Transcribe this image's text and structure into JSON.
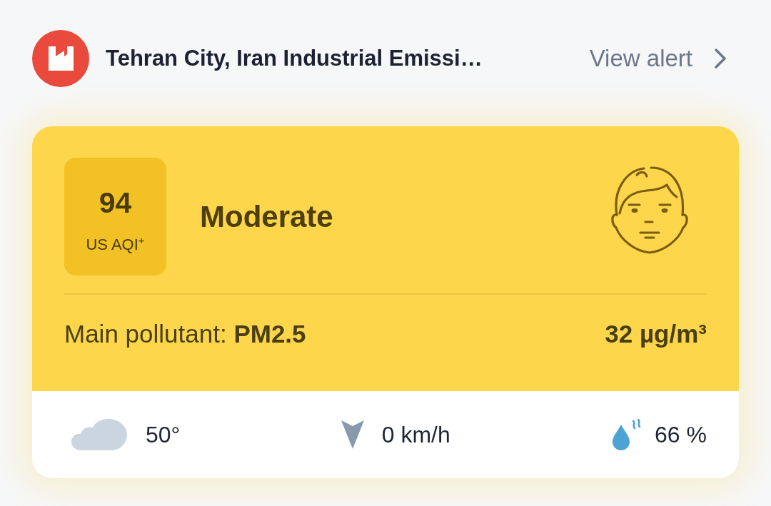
{
  "alert": {
    "title": "Tehran City, Iran Industrial Emissi…",
    "action": "View alert"
  },
  "aqi": {
    "value": "94",
    "unit": "US AQI$^{+}$",
    "category": "Moderate"
  },
  "pollutant": {
    "label": "Main pollutant: **PM2.5**",
    "concentration": "32 µg/m³"
  },
  "weather": [
    {
      "kind": "temperature",
      "value": "50°"
    },
    {
      "kind": "wind",
      "value": "0 km/h"
    },
    {
      "kind": "humidity",
      "value": "66 %"
    }
  ]
}
